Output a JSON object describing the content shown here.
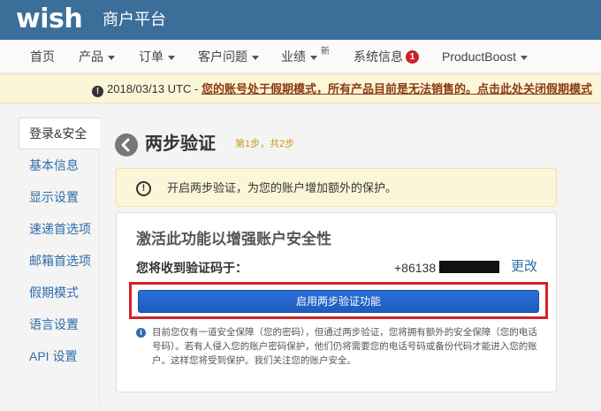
{
  "header": {
    "logo": "wish",
    "platform": "商户平台"
  },
  "nav": {
    "items": [
      {
        "label": "首页"
      },
      {
        "label": "产品"
      },
      {
        "label": "订单"
      },
      {
        "label": "客户问题"
      },
      {
        "label": "业绩",
        "sup": "新"
      },
      {
        "label": "系统信息",
        "badge": "1"
      },
      {
        "label": "ProductBoost"
      }
    ]
  },
  "banner": {
    "date": "2018/03/13 UTC - ",
    "link": "您的账号处于假期模式，所有产品目前是无法销售的。点击此处关闭假期模式"
  },
  "sidebar": {
    "items": [
      {
        "label": "登录&安全"
      },
      {
        "label": "基本信息"
      },
      {
        "label": "显示设置"
      },
      {
        "label": "速递首选项"
      },
      {
        "label": "邮箱首选项"
      },
      {
        "label": "假期模式"
      },
      {
        "label": "语言设置"
      },
      {
        "label": "API 设置"
      }
    ]
  },
  "page": {
    "title": "两步验证",
    "step": "第1步，共2步",
    "info": "开启两步验证，为您的账户增加额外的保护。"
  },
  "card": {
    "title": "激活此功能以增强账户安全性",
    "code_label": "您将收到验证码于：",
    "phone_prefix": "+86138",
    "change": "更改",
    "enable_button": "启用两步验证功能",
    "note": "目前您仅有一道安全保障（您的密码），但通过两步验证，您将拥有额外的安全保障（您的电话号码）。若有人侵入您的账户密码保护，他们仍将需要您的电话号码或备份代码才能进入您的账户。这样您将受到保护。我们关注您的账户安全。"
  },
  "colors": {
    "header": "#3b6f9a",
    "link": "#2f6ca7",
    "highlight": "#d3212c",
    "button": "#2a6fd6",
    "warning_bg": "#fcf6d9"
  }
}
